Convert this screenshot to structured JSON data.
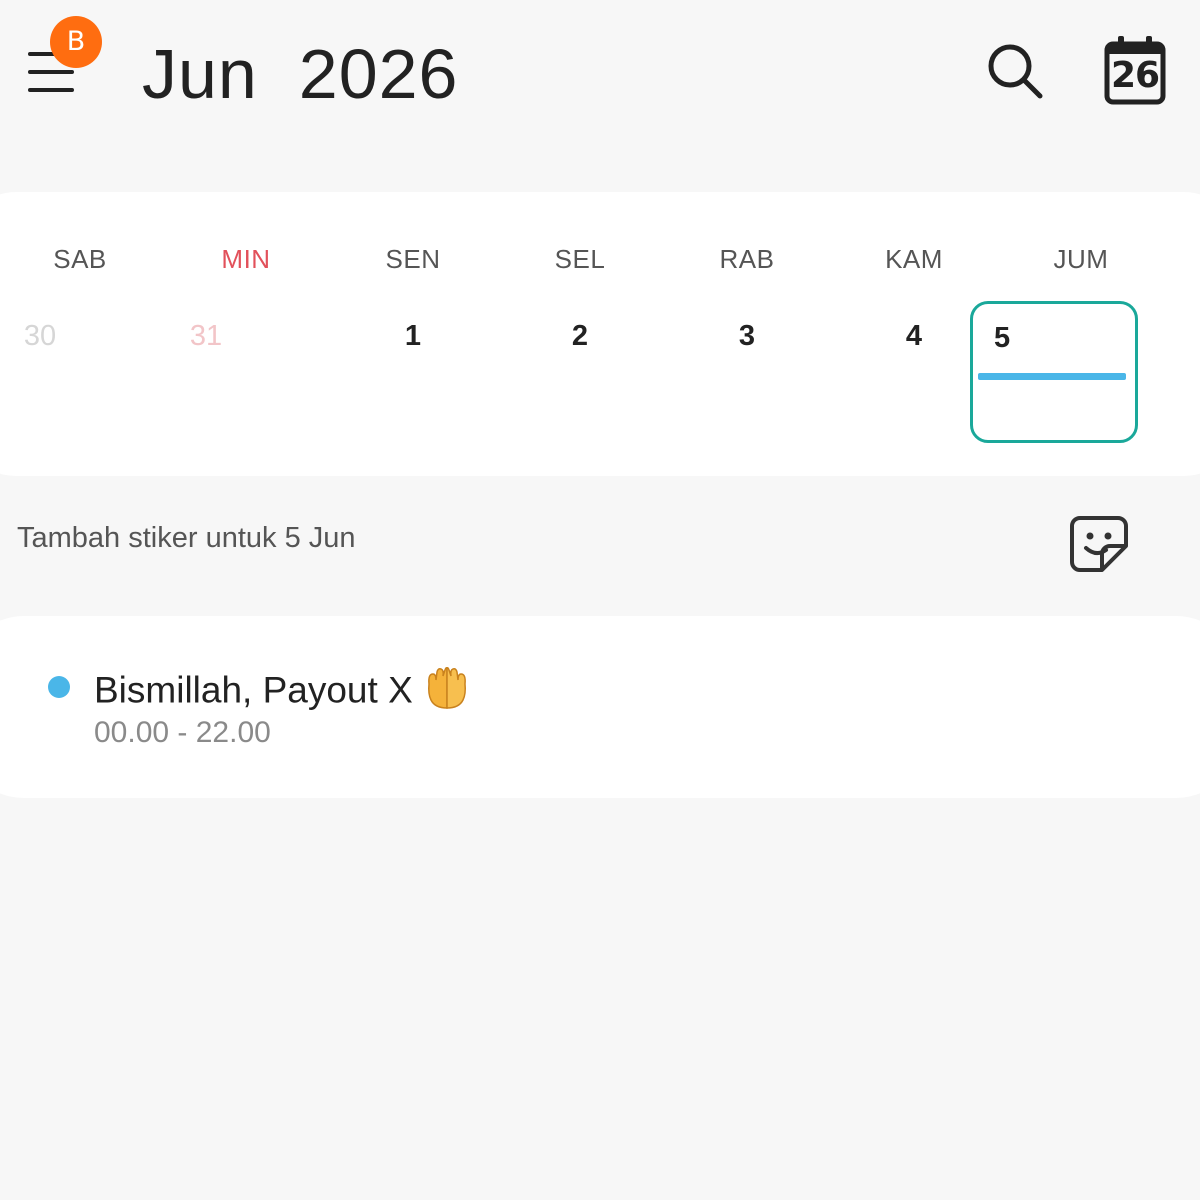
{
  "header": {
    "title": "Jun  2026",
    "badge": "B",
    "today_icon_number": "26"
  },
  "week": {
    "days": [
      "SAB",
      "MIN",
      "SEN",
      "SEL",
      "RAB",
      "KAM",
      "JUM"
    ],
    "dates": [
      "30",
      "31",
      "1",
      "2",
      "3",
      "4",
      "5"
    ],
    "selected_date": "5"
  },
  "sticker": {
    "prompt": "Tambah stiker untuk 5 Jun",
    "icon": "sticker-icon"
  },
  "event": {
    "title": "Bismillah, Payout X",
    "emoji": "palms-up-together",
    "time": "00.00 - 22.00"
  },
  "colors": {
    "accent": "#1aa89a",
    "event": "#4ab6e8",
    "badge": "#ff6d10",
    "sunday": "#e2515b"
  }
}
